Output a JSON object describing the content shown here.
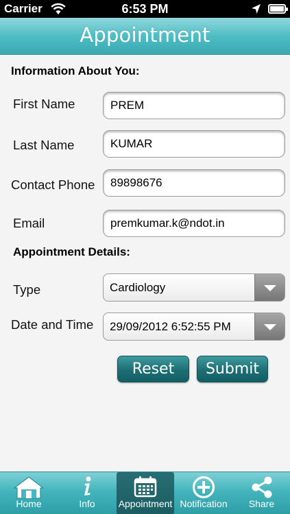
{
  "status_bar": {
    "carrier": "Carrier",
    "time": "6:53 PM",
    "wifi_icon": "wifi-icon",
    "location_icon": "location-arrow-icon",
    "battery_icon": "battery-full-icon"
  },
  "nav_bar": {
    "title": "Appointment"
  },
  "info_section": {
    "header": "Information About You:",
    "first_name": {
      "label": "First Name",
      "value": "PREM"
    },
    "last_name": {
      "label": "Last Name",
      "value": "KUMAR"
    },
    "phone": {
      "label": "Contact Phone",
      "value": "89898676"
    },
    "email": {
      "label": "Email",
      "value": "premkumar.k@ndot.in"
    }
  },
  "details_section": {
    "header": "Appointment Details:",
    "type": {
      "label": "Type",
      "value": "Cardiology"
    },
    "datetime": {
      "label": "Date and Time",
      "value": "29/09/2012 6:52:55 PM"
    }
  },
  "buttons": {
    "reset": "Reset",
    "submit": "Submit"
  },
  "tab_bar": {
    "items": [
      {
        "label": "Home",
        "icon": "home-icon",
        "active": false
      },
      {
        "label": "Info",
        "icon": "info-icon",
        "active": false
      },
      {
        "label": "Appointment",
        "icon": "calendar-icon",
        "active": true
      },
      {
        "label": "Notification",
        "icon": "plus-circle-icon",
        "active": false
      },
      {
        "label": "Share",
        "icon": "share-icon",
        "active": false
      }
    ]
  },
  "colors": {
    "accent_teal": "#4fbdc4",
    "button_teal": "#1d6e73",
    "active_tab": "#1a5c61"
  }
}
